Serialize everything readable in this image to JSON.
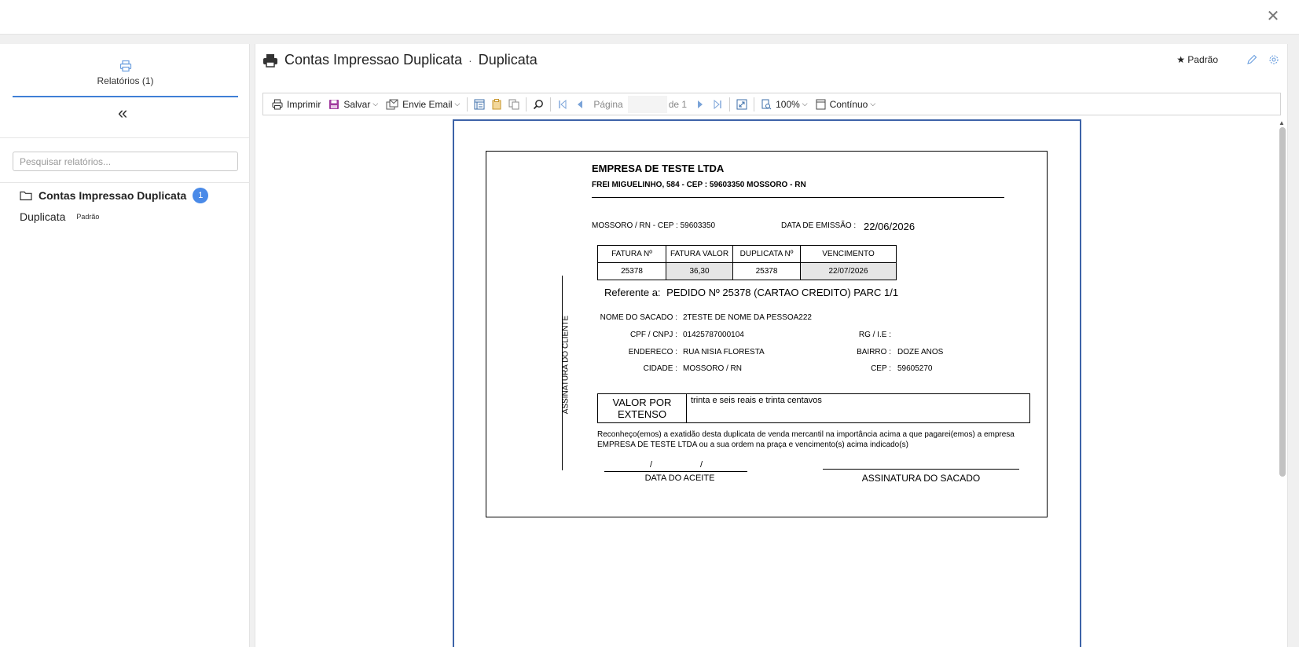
{
  "window": {
    "close_icon": "close-icon"
  },
  "sidebar": {
    "tab_label": "Relatórios (1)",
    "search_placeholder": "Pesquisar relatórios...",
    "folder": {
      "name": "Contas Impressao Duplicata",
      "count": "1"
    },
    "item": {
      "name": "Duplicata",
      "tag": "Padrão"
    }
  },
  "panel": {
    "title": "Contas Impressao Duplicata",
    "separator": "·",
    "subtitle": "Duplicata",
    "default_label": "★ Padrão"
  },
  "toolbar": {
    "print": "Imprimir",
    "save": "Salvar",
    "email": "Envie Email",
    "page_label": "Página",
    "page_value": "",
    "of_label": "de 1",
    "zoom": "100%",
    "mode": "Contínuo"
  },
  "document": {
    "company": "EMPRESA DE TESTE LTDA",
    "address": "FREI MIGUELINHO, 584 - CEP : 59603350 MOSSORO - RN",
    "city": "MOSSORO / RN - CEP : 59603350",
    "emission_label": "DATA DE EMISSÃO :",
    "emission_date": "22/06/2026",
    "table_headers": [
      "FATURA Nº",
      "FATURA VALOR",
      "DUPLICATA Nº",
      "VENCIMENTO"
    ],
    "table_values": [
      "25378",
      "36,30",
      "25378",
      "22/07/2026"
    ],
    "vertical_label": "ASSINATURA DO CLIENTE",
    "ref_label": "Referente a:",
    "ref_value": "PEDIDO Nº 25378 (CARTAO CREDITO) PARC 1/1",
    "sacado_label": "NOME DO SACADO :",
    "sacado_value": "2TESTE DE NOME DA PESSOA222",
    "cpf_label": "CPF / CNPJ :",
    "cpf_value": "01425787000104",
    "rg_label": "RG / I.E :",
    "rg_value": "",
    "endereco_label": "ENDERECO :",
    "endereco_value": "RUA NISIA FLORESTA",
    "bairro_label": "BAIRRO :",
    "bairro_value": "DOZE ANOS",
    "cidade_label": "CIDADE :",
    "cidade_value": "MOSSORO / RN",
    "cep_label": "CEP :",
    "cep_value": "59605270",
    "extenso_label_1": "VALOR POR",
    "extenso_label_2": "EXTENSO",
    "extenso_value": "trinta e seis reais e trinta centavos",
    "declaration": "Reconheço(emos) a exatidão desta duplicata de venda mercantil na importância acima a que pagarei(emos) a empresa EMPRESA DE TESTE LTDA ou a sua ordem na praça e vencimento(s) acima indicado(s)",
    "date_slash": "/",
    "date_label": "DATA DO ACEITE",
    "signature_label": "ASSINATURA DO SACADO"
  },
  "colors": {
    "accent": "#3f7fd6",
    "badge": "#4a8ae8",
    "paper_border": "#3d63a8"
  }
}
